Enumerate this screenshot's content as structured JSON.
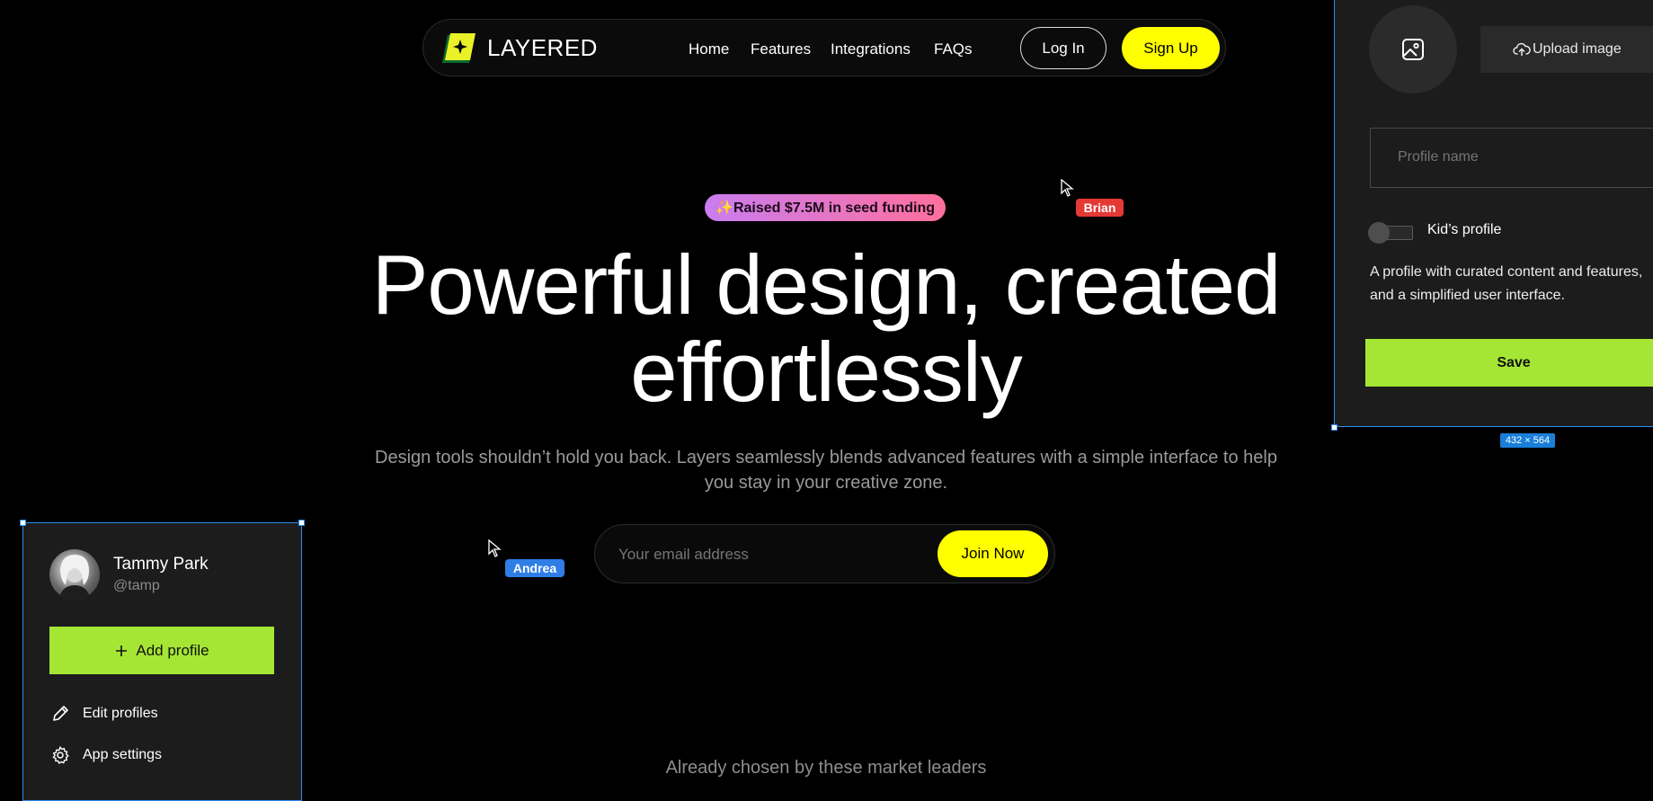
{
  "nav": {
    "brand": "LAYERED",
    "links": [
      "Home",
      "Features",
      "Integrations",
      "FAQs"
    ],
    "login_label": "Log In",
    "signup_label": "Sign Up"
  },
  "hero": {
    "badge": "✨Raised $7.5M in seed funding",
    "title_line1": "Powerful design, created",
    "title_line2": "effortlessly",
    "subtitle_line1": "Design tools shouldn’t hold you back. Layers seamlessly blends advanced features with a simple interface to help",
    "subtitle_line2": "you stay in your creative zone.",
    "email_placeholder": "Your email address",
    "join_label": "Join Now",
    "leaders_text": "Already chosen by these market leaders"
  },
  "cursors": [
    {
      "name": "Brian",
      "color": "#e53935"
    },
    {
      "name": "Andrea",
      "color": "#2f7ee6"
    }
  ],
  "profile_panel": {
    "user_name": "Tammy Park",
    "user_handle": "@tamp",
    "add_label": "Add profile",
    "menu": [
      {
        "label": "Edit profiles",
        "icon": "pencil-icon"
      },
      {
        "label": "App settings",
        "icon": "gear-icon"
      }
    ]
  },
  "edit_panel": {
    "upload_label": "Upload image",
    "profile_name_placeholder": "Profile name",
    "kids_label": "Kid’s profile",
    "description_line1": "A profile with curated content and features,",
    "description_line2": "and a simplified user interface.",
    "save_label": "Save",
    "size_tag": "432 × 564"
  },
  "colors": {
    "accent_yellow": "#ffff00",
    "accent_green": "#a4e633",
    "selection_blue": "#2d8cf0"
  }
}
